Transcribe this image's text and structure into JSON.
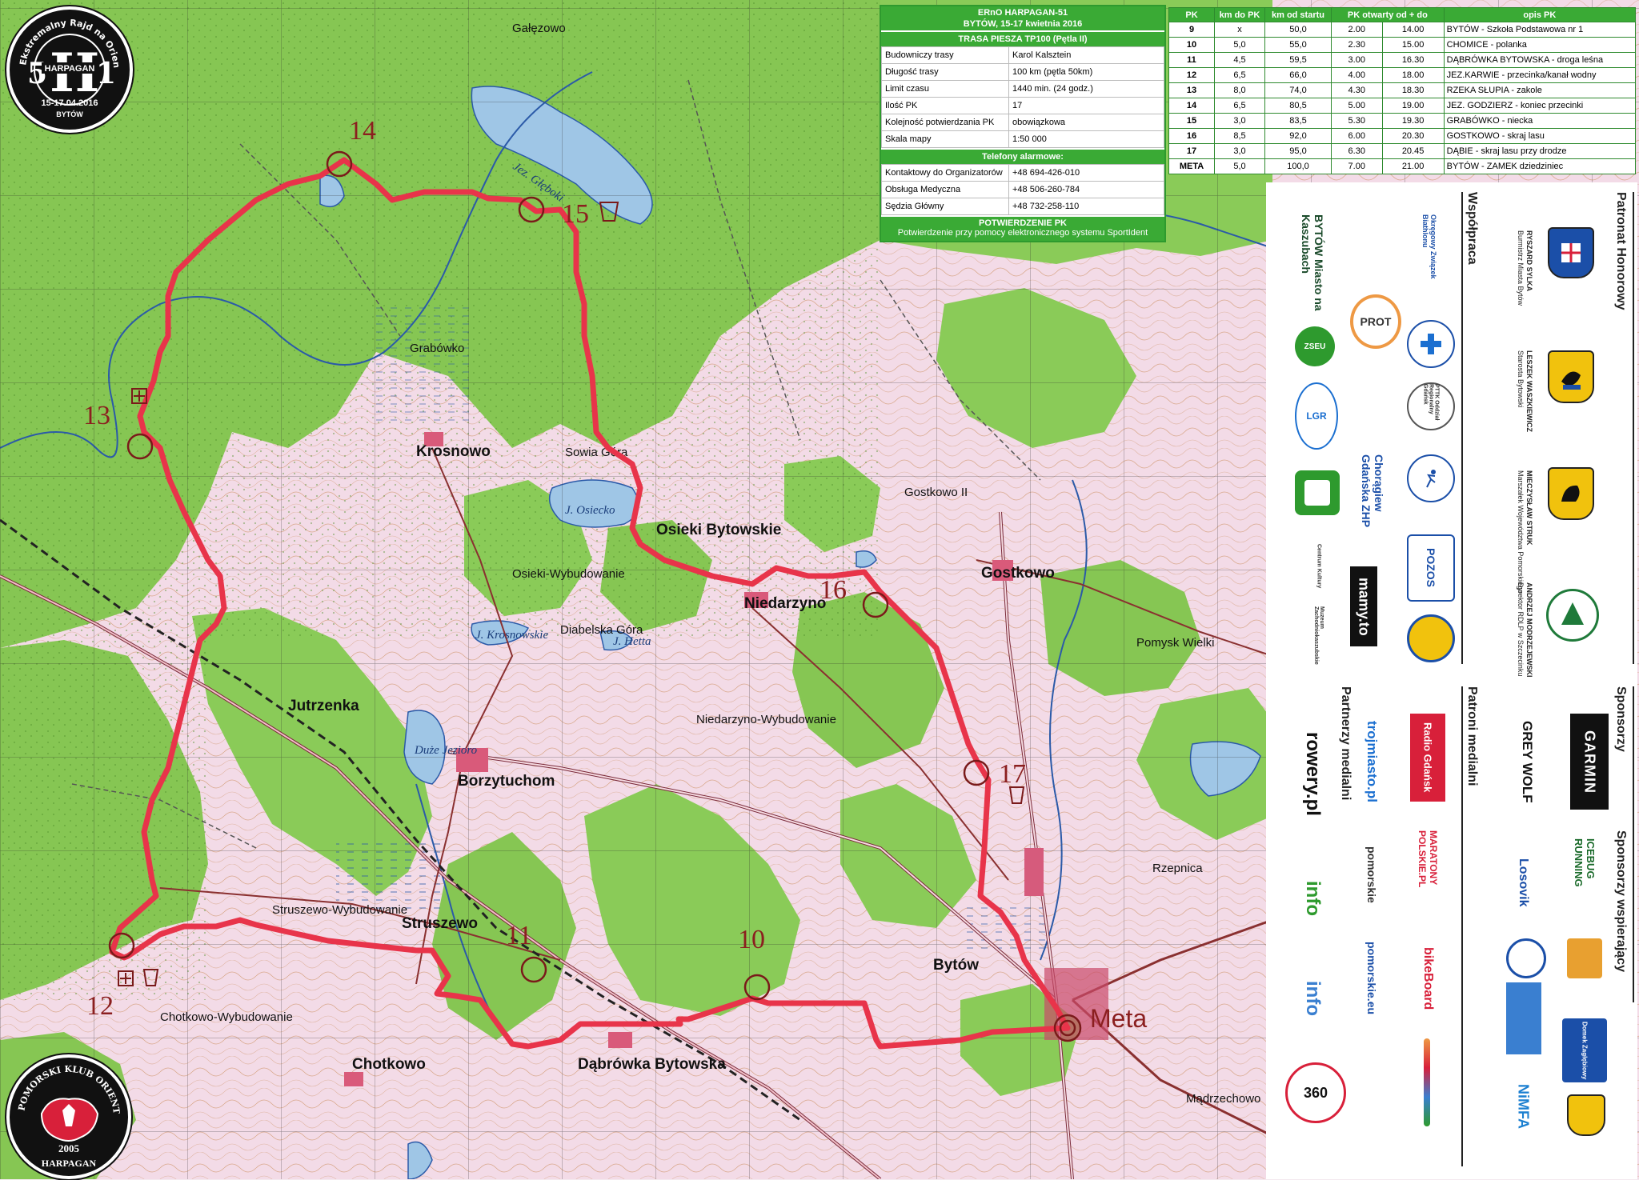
{
  "badge_top": {
    "ring_text": "Ekstremalny Rajd na Orientację",
    "big_letter": "H",
    "number_left": "5",
    "number_right": "1",
    "name": "HARPAGAN",
    "dates": "15-17.04.2016",
    "city": "BYTÓW"
  },
  "badge_bottom": {
    "ring_text": "POMORSKI KLUB ORIENTACJI",
    "year": "2005",
    "name": "HARPAGAN"
  },
  "info": {
    "title": "ERnO HARPAGAN-51",
    "subtitle": "BYTÓW, 15-17 kwietnia 2016",
    "route_title": "TRASA PIESZA TP100 (Pętla II)",
    "rows": [
      {
        "key": "Budowniczy trasy",
        "value": "Karol Kalsztein"
      },
      {
        "key": "Długość trasy",
        "value": "100 km (pętla 50km)"
      },
      {
        "key": "Limit czasu",
        "value": "1440 min. (24 godz.)"
      },
      {
        "key": "Ilość PK",
        "value": "17"
      },
      {
        "key": "Kolejność potwierdzania PK",
        "value": "obowiązkowa"
      },
      {
        "key": "Skala mapy",
        "value": "1:50 000"
      }
    ],
    "phones_title": "Telefony alarmowe:",
    "phones": [
      {
        "key": "Kontaktowy do Organizatorów",
        "value": "+48 694-426-010"
      },
      {
        "key": "Obsługa Medyczna",
        "value": "+48 506-260-784"
      },
      {
        "key": "Sędzia Główny",
        "value": "+48 732-258-110"
      }
    ],
    "confirm_title": "POTWIERDZENIE PK",
    "confirm_text": "Potwierdzenie przy pomocy elektronicznego systemu SportIdent"
  },
  "checkpoints": {
    "headers": [
      "PK",
      "km do PK",
      "km od startu",
      "PK otwarty od + do",
      "",
      "opis PK"
    ],
    "rows": [
      {
        "pk": "9",
        "km_to": "x",
        "km_from": "50,0",
        "open": "2.00",
        "close": "14.00",
        "desc": "BYTÓW - Szkoła Podstawowa nr 1"
      },
      {
        "pk": "10",
        "km_to": "5,0",
        "km_from": "55,0",
        "open": "2.30",
        "close": "15.00",
        "desc": "CHOMICE - polanka"
      },
      {
        "pk": "11",
        "km_to": "4,5",
        "km_from": "59,5",
        "open": "3.00",
        "close": "16.30",
        "desc": "DĄBRÓWKA BYTOWSKA - droga leśna"
      },
      {
        "pk": "12",
        "km_to": "6,5",
        "km_from": "66,0",
        "open": "4.00",
        "close": "18.00",
        "desc": "JEZ.KARWIE - przecinka/kanał wodny"
      },
      {
        "pk": "13",
        "km_to": "8,0",
        "km_from": "74,0",
        "open": "4.30",
        "close": "18.30",
        "desc": "RZEKA SŁUPIA - zakole"
      },
      {
        "pk": "14",
        "km_to": "6,5",
        "km_from": "80,5",
        "open": "5.00",
        "close": "19.00",
        "desc": "JEZ. GODZIERZ - koniec przecinki"
      },
      {
        "pk": "15",
        "km_to": "3,0",
        "km_from": "83,5",
        "open": "5.30",
        "close": "19.30",
        "desc": "GRABÓWKO - niecka"
      },
      {
        "pk": "16",
        "km_to": "8,5",
        "km_from": "92,0",
        "open": "6.00",
        "close": "20.30",
        "desc": "GOSTKOWO - skraj lasu"
      },
      {
        "pk": "17",
        "km_to": "3,0",
        "km_from": "95,0",
        "open": "6.30",
        "close": "20.45",
        "desc": "DĄBIE - skraj lasu przy drodze"
      },
      {
        "pk": "META",
        "km_to": "5,0",
        "km_from": "100,0",
        "open": "7.00",
        "close": "21.00",
        "desc": "BYTÓW - ZAMEK dziedziniec"
      }
    ]
  },
  "map": {
    "checkpoint_labels": [
      "10",
      "11",
      "12",
      "13",
      "14",
      "15",
      "16",
      "17"
    ],
    "finish_label": "Meta",
    "towns": [
      "Borzytuchom",
      "Niedarzyno",
      "Osieki Bytowskie",
      "Gostkowo",
      "Jutrzenka",
      "Struszewo",
      "Dąbrówka Bytowska",
      "Chotkowo",
      "Krosnowo",
      "Bytów",
      "Rzepnica",
      "Grabówko",
      "Gałęzowo",
      "Pomysk Wielki",
      "Mądrzechowo",
      "Chotkowo-Wybudowanie",
      "Struszewo-Wybudowanie",
      "Niedarzyno-Wybudowanie",
      "Osieki-Wybudowanie",
      "Gostkowo II",
      "Sowia Góra",
      "Diabelska Góra"
    ],
    "lakes": [
      "Jez. Głęboki",
      "J. Osiecko",
      "Duże Jezioro",
      "J. Hetta",
      "J. Krosnowskie"
    ],
    "colors": {
      "route": "#e8344a",
      "forest": "#7dc24b",
      "meadow": "#f0c9dc",
      "water": "#9fc6e6",
      "contour": "#c07a3a"
    }
  },
  "partners": {
    "honorary_title": "Patronat Honorowy",
    "honorary": [
      {
        "name": "RYSZARD SYLKA",
        "role": "Burmistrz Miasta Bytów"
      },
      {
        "name": "LESZEK WASZKIEWICZ",
        "role": "Starosta Bytowski"
      },
      {
        "name": "MIECZYSŁAW STRUK",
        "role": "Marszałek Województwa Pomorskiego"
      },
      {
        "name": "ANDRZEJ MODRZEJEWSKI",
        "role": "Dyrektor RDLP w Szczecinku"
      }
    ],
    "coop_title": "Współpraca",
    "coop_logos": [
      "BYTÓW Miasto na Kaszubach",
      "Okręgowy Związek Biathlonu",
      "PROT",
      "ZSEU",
      "LGR",
      "PTTK Oddział Regionalny Gdańsk",
      "Chorągiew Gdańska ZHP",
      "POZOS",
      "mamy.to",
      "Centrum Kultury",
      "Muzeum Zachodniokaszubskie"
    ],
    "sponsors_title": "Sponsorzy",
    "sponsors": [
      "GARMIN",
      "GREY WOLF"
    ],
    "supporting_title": "Sponsorzy wspierający",
    "supporting": [
      "ICEBUG RUNNING",
      "Losovik",
      "Domek Zagłębiowy",
      "NiMFA"
    ],
    "media_patrons_title": "Patroni medialni",
    "media_patrons": [
      "Radio Gdańsk",
      "trojmiasto.pl",
      "MARATONY POLSKIE.PL",
      "pomorskie",
      "bikeBoard",
      "pomorskie.eu"
    ],
    "media_partners_title": "Partnerzy medialni",
    "media_partners": [
      "rowery.pl",
      "info",
      "info",
      "360"
    ]
  }
}
